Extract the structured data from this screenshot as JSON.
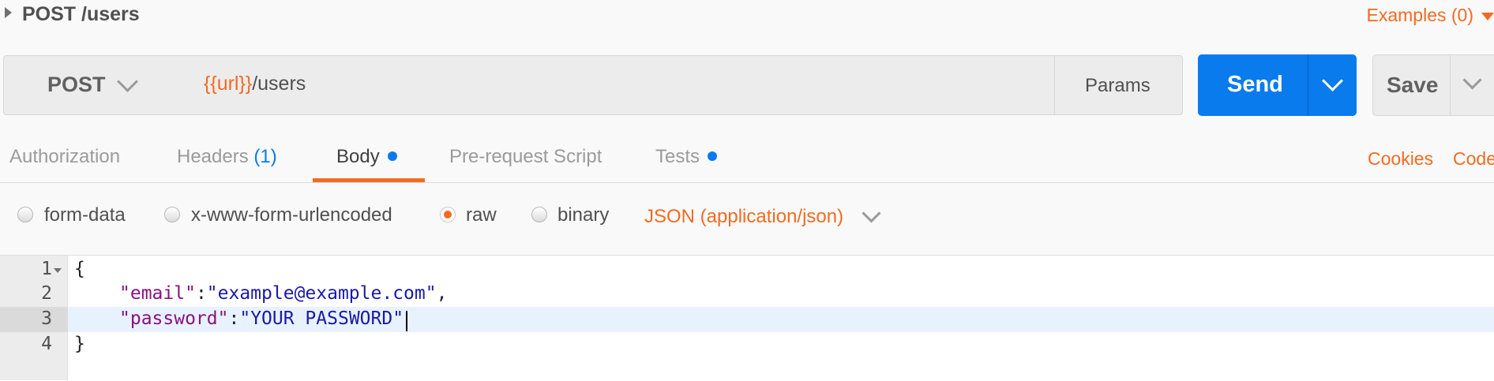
{
  "request": {
    "title": "POST /users",
    "examples_label": "Examples (0)",
    "method": "POST",
    "url_variable": "{{url}}",
    "url_path": "/users",
    "params_label": "Params",
    "send_label": "Send",
    "save_label": "Save"
  },
  "tabs": {
    "authorization": "Authorization",
    "headers": "Headers",
    "headers_count": "(1)",
    "body": "Body",
    "prerequest": "Pre-request Script",
    "tests": "Tests",
    "cookies": "Cookies",
    "code": "Code"
  },
  "body_types": {
    "form_data": "form-data",
    "urlencoded": "x-www-form-urlencoded",
    "raw": "raw",
    "binary": "binary",
    "selected": "raw",
    "content_type": "JSON (application/json)"
  },
  "editor": {
    "line_numbers": [
      "1",
      "2",
      "3",
      "4"
    ],
    "active_line": "3",
    "line1": "{",
    "line2_key": "\"email\"",
    "line2_colon": ":",
    "line2_value": "\"example@example.com\"",
    "line2_comma": ",",
    "line3_key": "\"password\"",
    "line3_colon": ":",
    "line3_value": "\"YOUR PASSWORD\"",
    "line4": "}"
  },
  "colors": {
    "accent_orange": "#f26b21",
    "send_blue": "#097bed"
  }
}
